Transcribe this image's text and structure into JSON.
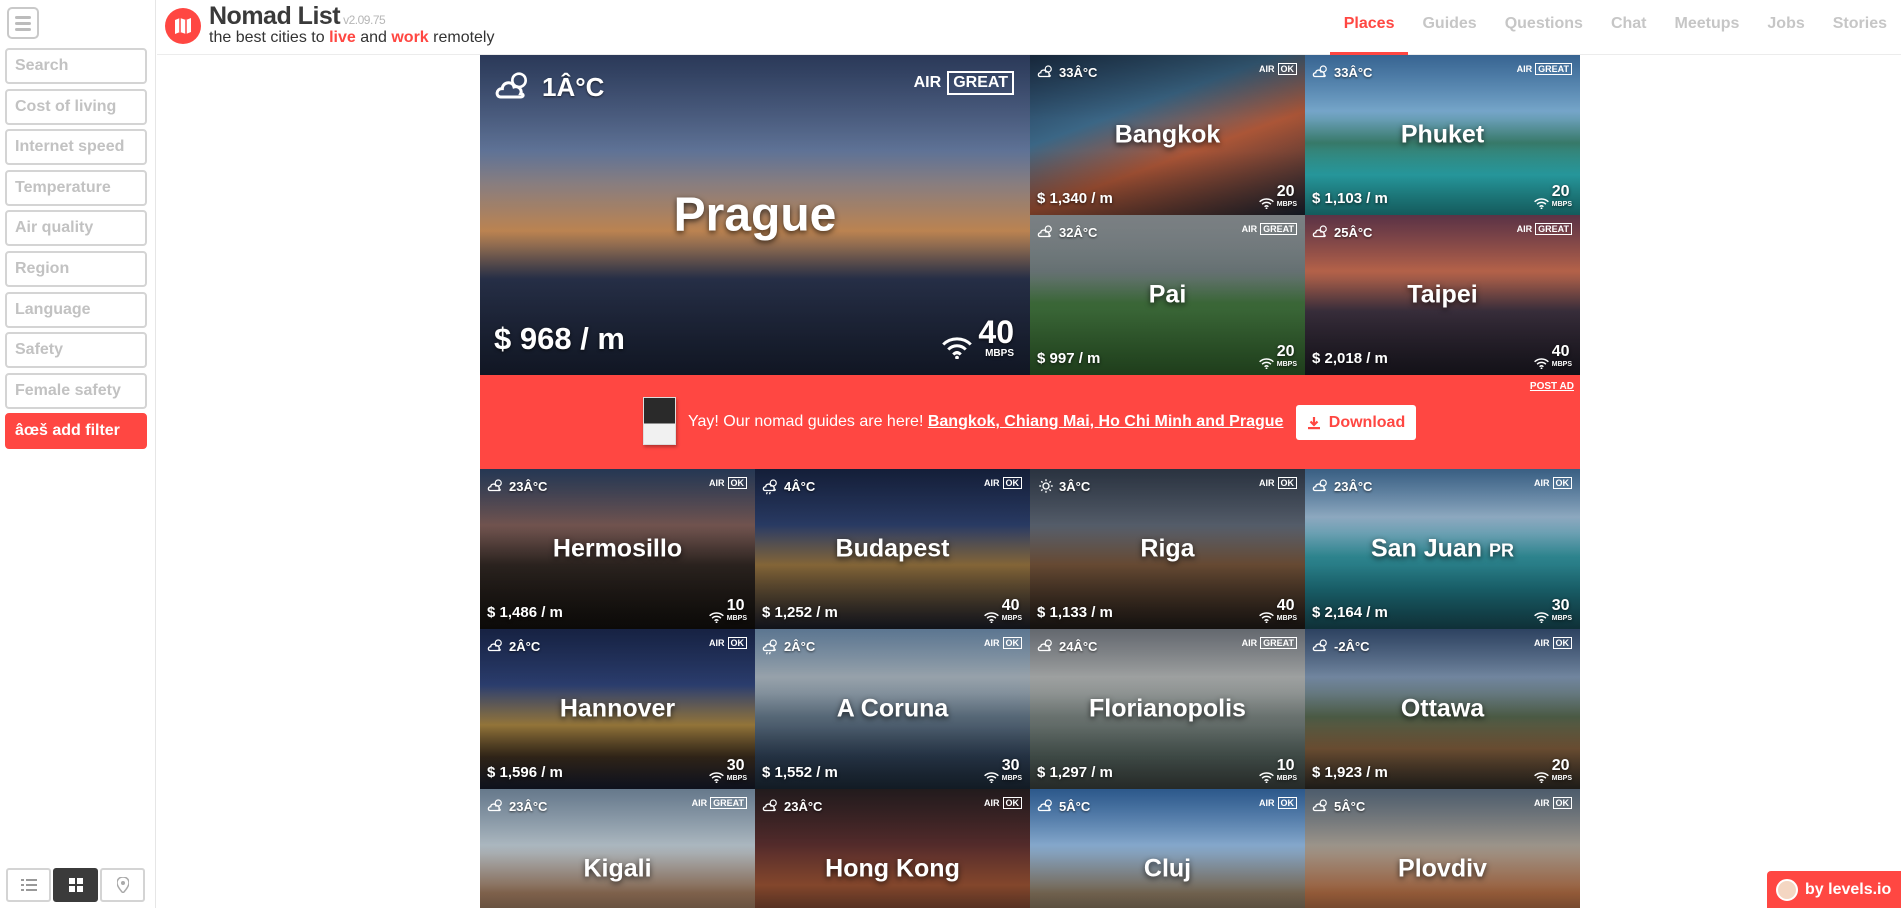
{
  "sidebar": {
    "filters": [
      "Search",
      "Cost of living",
      "Internet speed",
      "Temperature",
      "Air quality",
      "Region",
      "Language",
      "Safety",
      "Female safety"
    ],
    "add_filter_label": "âœš add filter"
  },
  "header": {
    "brand": "Nomad List",
    "version": "v2.09.75",
    "tagline": {
      "prefix": "the best cities to ",
      "live": "live",
      "and": " and ",
      "work": "work",
      "suffix": " remotely"
    },
    "nav": [
      "Places",
      "Guides",
      "Questions",
      "Chat",
      "Meetups",
      "Jobs",
      "Stories"
    ],
    "active_nav": "Places"
  },
  "promo": {
    "text": "Yay! Our nomad guides are here! ",
    "link": "Bangkok, Chiang Mai, Ho Chi Minh and Prague",
    "download_label": "Download",
    "post_ad": "POST AD"
  },
  "maker": {
    "label": "by levels.io"
  },
  "air_label": "AIR",
  "unit_label": "MBPS",
  "colors": {
    "accent": "#ff4742"
  },
  "cities": [
    {
      "name": "Prague",
      "temp": "1Â°C",
      "air": "GREAT",
      "cost": "$ 968 / m",
      "internet": "40",
      "weather": "cloud-sun",
      "bg": "linear-gradient(180deg,#3b4f7a 0%,#6a80a8 30%,#c58a55 55%,#2b3550 70%,#1a2236 100%)"
    },
    {
      "name": "Bangkok",
      "temp": "33Â°C",
      "air": "OK",
      "cost": "$ 1,340 / m",
      "internet": "20",
      "weather": "cloud-sun",
      "bg": "linear-gradient(160deg,#1f3550 0%,#3e6b8c 35%,#b45a3a 60%,#1b2433 100%)"
    },
    {
      "name": "Phuket",
      "temp": "33Â°C",
      "air": "GREAT",
      "cost": "$ 1,103 / m",
      "internet": "20",
      "weather": "cloud-sun",
      "bg": "linear-gradient(180deg,#4d8bc9 0%,#7fb3da 35%,#3a7f6e 55%,#2db3b8 75%,#1f8c8e 100%)"
    },
    {
      "name": "Pai",
      "temp": "32Â°C",
      "air": "GREAT",
      "cost": "$ 997 / m",
      "internet": "20",
      "weather": "cloud-sun",
      "bg": "linear-gradient(180deg,#a9b0b5 0%,#6e7a7c 35%,#3d6b3a 55%,#2f5e2a 100%)"
    },
    {
      "name": "Taipei",
      "temp": "25Â°C",
      "air": "GREAT",
      "cost": "$ 2,018 / m",
      "internet": "40",
      "weather": "cloud-sun",
      "bg": "linear-gradient(180deg,#7e4660 0%,#c36a4f 35%,#3a2f3d 60%,#1d1a24 100%)"
    },
    {
      "name": "Hermosillo",
      "temp": "23Â°C",
      "air": "OK",
      "cost": "$ 1,486 / m",
      "internet": "10",
      "weather": "cloud-sun",
      "bg": "linear-gradient(180deg,#334c73 0%,#7a5a55 35%,#2c2420 60%,#120f0c 100%)"
    },
    {
      "name": "Budapest",
      "temp": "4Â°C",
      "air": "OK",
      "cost": "$ 1,252 / m",
      "internet": "40",
      "weather": "cloud-rain",
      "bg": "linear-gradient(180deg,#1c2a4e 0%,#2c3f6b 35%,#8a6a3a 60%,#1a1d28 100%)"
    },
    {
      "name": "Riga",
      "temp": "3Â°C",
      "air": "OK",
      "cost": "$ 1,133 / m",
      "internet": "40",
      "weather": "sun",
      "bg": "linear-gradient(180deg,#3a4658 0%,#5b6472 35%,#6b4d35 60%,#1f1a17 100%)"
    },
    {
      "name": "San Juan",
      "suffix": "PR",
      "temp": "23Â°C",
      "air": "OK",
      "cost": "$ 2,164 / m",
      "internet": "30",
      "weather": "cloud-sun",
      "bg": "linear-gradient(180deg,#4f83b5 0%,#9dbcd6 30%,#2f8a94 55%,#1d6f7a 75%,#174a55 100%)"
    },
    {
      "name": "Hannover",
      "temp": "2Â°C",
      "air": "OK",
      "cost": "$ 1,596 / m",
      "internet": "30",
      "weather": "cloud-sun",
      "bg": "linear-gradient(180deg,#1f2f5c 0%,#2e4276 35%,#9a7a3c 60%,#3a2c1d 80%,#151a2c 100%)"
    },
    {
      "name": "A Coruna",
      "temp": "2Â°C",
      "air": "OK",
      "cost": "$ 1,552 / m",
      "internet": "30",
      "weather": "cloud-rain",
      "bg": "linear-gradient(180deg,#7fa3c8 0%,#a9b5bf 30%,#5a6c7c 55%,#2c3d52 80%,#1c2937 100%)"
    },
    {
      "name": "Florianopolis",
      "temp": "24Â°C",
      "air": "GREAT",
      "cost": "$ 1,297 / m",
      "internet": "10",
      "weather": "cloud-sun",
      "bg": "linear-gradient(180deg,#8a9099 0%,#b0b3b3 30%,#6e7774 55%,#4c5a55 80%,#3a403d 100%)"
    },
    {
      "name": "Ottawa",
      "temp": "-2Â°C",
      "air": "OK",
      "cost": "$ 1,923 / m",
      "internet": "20",
      "weather": "cloud-sun",
      "bg": "linear-gradient(180deg,#3f5c86 0%,#7e95b1 30%,#4e5e47 55%,#7c5a3a 75%,#2d2a25 100%)"
    },
    {
      "name": "Kigali",
      "temp": "23Â°C",
      "air": "GREAT",
      "cost": "",
      "internet": "",
      "weather": "cloud-sun",
      "bg": "linear-gradient(180deg,#8da7c1 0%,#b9c6cf 35%,#8a6a52 65%,#5a4a3e 100%)"
    },
    {
      "name": "Hong Kong",
      "temp": "23Â°C",
      "air": "OK",
      "cost": "",
      "internet": "",
      "weather": "cloud-sun",
      "bg": "linear-gradient(180deg,#2f2528 0%,#5a2e2e 35%,#8a4a2e 60%,#2a1f1f 100%)"
    },
    {
      "name": "Cluj",
      "temp": "5Â°C",
      "air": "OK",
      "cost": "",
      "internet": "",
      "weather": "cloud-sun",
      "bg": "linear-gradient(180deg,#3d7ac0 0%,#8fb5dc 35%,#7a6a55 65%,#4a3e33 100%)"
    },
    {
      "name": "Plovdiv",
      "temp": "5Â°C",
      "air": "OK",
      "cost": "",
      "internet": "",
      "weather": "cloud-sun",
      "bg": "linear-gradient(180deg,#6a7f95 0%,#a8a095 35%,#a0623d 65%,#5a3a28 100%)"
    }
  ]
}
